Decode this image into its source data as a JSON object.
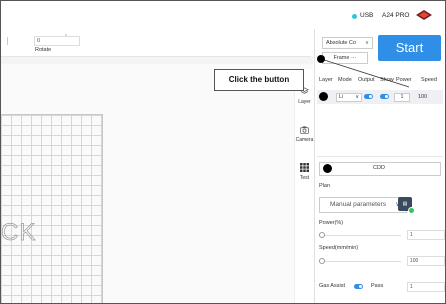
{
  "topbar": {
    "connection": "USB",
    "device": "A24 PRO",
    "logo_icon": "brand-logo-icon",
    "status_color": "#2dc6d6"
  },
  "properties": {
    "rotate_value": "0",
    "rotate_unit": "°",
    "rotate_label": "Rotate"
  },
  "canvas": {
    "text": "CK"
  },
  "sidebar": {
    "items": [
      {
        "label": "Layer",
        "icon": "layers-icon"
      },
      {
        "label": "Camera",
        "icon": "camera-icon"
      },
      {
        "label": "Test",
        "icon": "grid-icon"
      }
    ]
  },
  "controls": {
    "positioning": "Absolute Co",
    "frame_label": "Frame",
    "frame_more": "···",
    "start_label": "Start",
    "start_color": "#2f8fe6"
  },
  "callout": {
    "text": "Click the button"
  },
  "layer_table": {
    "headers": [
      "Layer",
      "Mode",
      "Output",
      "Show",
      "Power",
      "Speed"
    ],
    "row": {
      "mode": "Li",
      "power": "1",
      "speed": "100"
    }
  },
  "process": {
    "layer_name": "CDD",
    "plan_label": "Plan",
    "plan_value": "Manual parameters",
    "power_label": "Power(%)",
    "power_value": "1",
    "speed_label": "Speed(mm/min)",
    "speed_value": "100",
    "gas_assist_label": "Gas Assist",
    "pass_label": "Pass",
    "pass_value": "1"
  }
}
